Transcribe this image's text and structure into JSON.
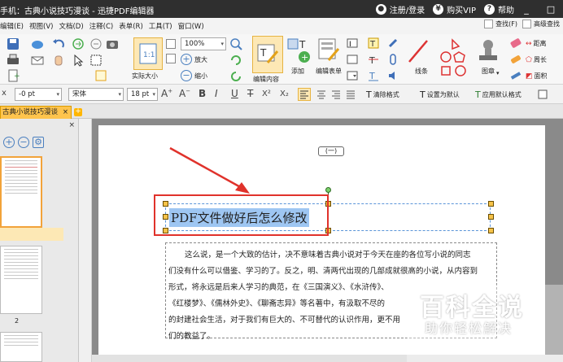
{
  "window": {
    "title": "手机：古典小说技巧漫谈 - 迅捷PDF编辑器",
    "register_label": "注册/登录",
    "buy_label": "购买VIP",
    "help_label": "帮助",
    "minimize_glyph": "_",
    "maximize_glyph": "□"
  },
  "menubar": {
    "items": [
      "编辑(E)",
      "视图(V)",
      "文档(D)",
      "注释(C)",
      "表单(R)",
      "工具(T)",
      "窗口(W)"
    ],
    "find_label": "查找(F)",
    "advanced_find_label": "高级查找"
  },
  "toolbar": {
    "zoom_value": "100%",
    "zoom_in_label": "放大",
    "zoom_out_label": "缩小",
    "actual_size_label": "实际大小",
    "edit_content_label": "编辑内容",
    "add_label": "添加",
    "edit_form_label": "编辑表单",
    "line_label": "线条",
    "stamp_label": "图章",
    "distance_label": "距离",
    "perimeter_label": "周长",
    "area_label": "面积"
  },
  "formatbar": {
    "size_value": "-0 pt",
    "font_family": "宋体",
    "font_size": "18 pt",
    "bold": "B",
    "italic": "I",
    "underline": "U",
    "strike": "T",
    "superscript": "X²",
    "subscript": "X₂",
    "clear_format_label": "清除格式",
    "set_default_label": "设置为默认",
    "apply_default_label": "应用默认格式"
  },
  "tabs": {
    "doc_tab_label": "古典小说技巧漫谈",
    "close_glyph": "×",
    "add_glyph": "+"
  },
  "sidebar": {
    "close_glyph": "×",
    "pages": [
      {
        "number": "1"
      },
      {
        "number": "2"
      }
    ]
  },
  "document": {
    "section_mark": "(一)",
    "heading": "PDF文件做好后怎么修改",
    "lines": [
      "这么说，是一个大致的估计，决不意味着古典小说对于今天在座的各位写小说的同志",
      "们没有什么可以借鉴、学习的了。反之，明、清两代出现的几部成就很高的小说，从内容到",
      "形式，将永远是后来人学习的典范，在《三国演义》、《水浒传》、",
      "《红楼梦》、《儒林外史》、《聊斋志异》等名著中，有汲取不尽的",
      "的封建社会生活，对于我们有巨大的、不可替代的认识作用，更不用",
      "们的教益了。"
    ]
  },
  "watermark": {
    "title": "百科全说",
    "subtitle": "助你轻松解决"
  },
  "colors": {
    "titlebar_bg": "#2f2f2f",
    "tab_active": "#ffc44d",
    "selection": "#9ec6f2",
    "red_annotation": "#e0322b",
    "handle": "#f6c34a"
  }
}
